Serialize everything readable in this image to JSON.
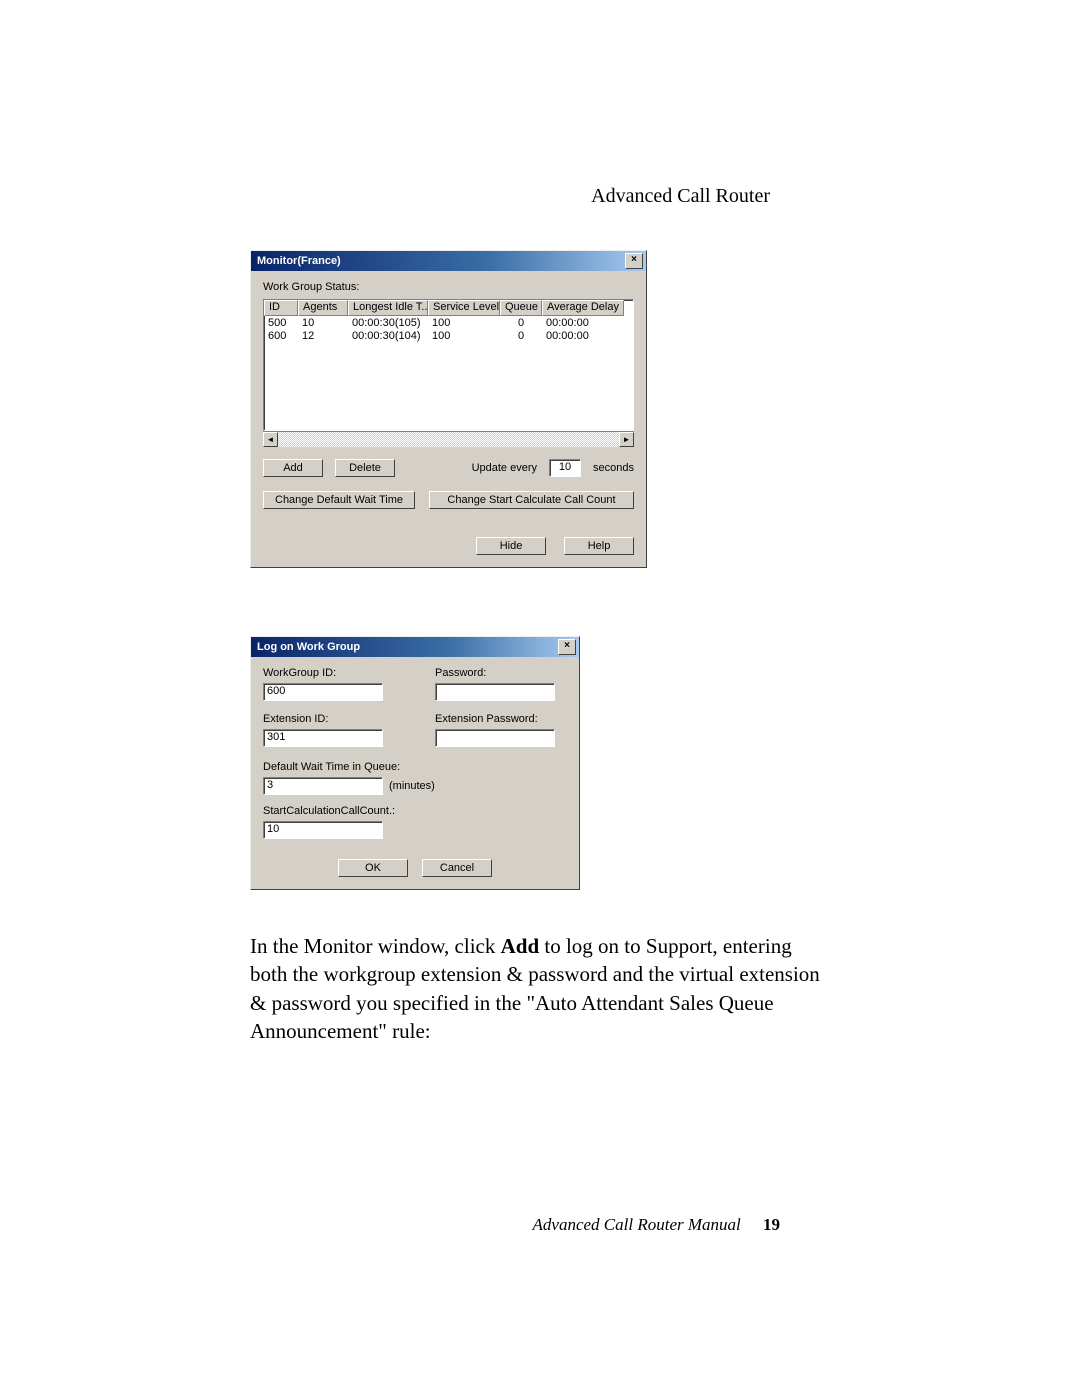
{
  "page": {
    "running_head": "Advanced Call Router",
    "body_text_pre": "In the Monitor window, click ",
    "body_text_bold": "Add",
    "body_text_post": " to log on to Support, entering both the workgroup extension & password and the virtual extension & password you specified in the \"Auto Attendant Sales Queue Announcement\" rule:",
    "footer_manual": "Advanced Call Router Manual",
    "footer_page": "19"
  },
  "monitor": {
    "title": "Monitor(France)",
    "close_glyph": "×",
    "status_label": "Work Group Status:",
    "columns": {
      "id": "ID",
      "agents": "Agents",
      "longest_idle": "Longest Idle T...",
      "service_level": "Service Level",
      "queue": "Queue",
      "avg_delay": "Average Delay ..."
    },
    "rows": [
      {
        "id": "500",
        "agents": "10",
        "longest_idle": "00:00:30(105)",
        "service_level": "100",
        "queue": "0",
        "avg_delay": "00:00:00"
      },
      {
        "id": "600",
        "agents": "12",
        "longest_idle": "00:00:30(104)",
        "service_level": "100",
        "queue": "0",
        "avg_delay": "00:00:00"
      }
    ],
    "scroll_left": "◄",
    "scroll_right": "►",
    "buttons": {
      "add": "Add",
      "delete": "Delete",
      "change_wait": "Change Default Wait Time",
      "change_count": "Change Start Calculate Call Count",
      "hide": "Hide",
      "help": "Help"
    },
    "update_label_pre": "Update every",
    "update_value": "10",
    "update_label_post": "seconds"
  },
  "logon": {
    "title": "Log on Work Group",
    "close_glyph": "×",
    "labels": {
      "workgroup_id": "WorkGroup ID:",
      "password": "Password:",
      "extension_id": "Extension ID:",
      "extension_password": "Extension Password:",
      "default_wait": "Default Wait Time in Queue:",
      "minutes": "(minutes)",
      "start_calc": "StartCalculationCallCount.:"
    },
    "values": {
      "workgroup_id": "600",
      "password": "",
      "extension_id": "301",
      "extension_password": "",
      "default_wait": "3",
      "start_calc": "10"
    },
    "buttons": {
      "ok": "OK",
      "cancel": "Cancel"
    }
  }
}
